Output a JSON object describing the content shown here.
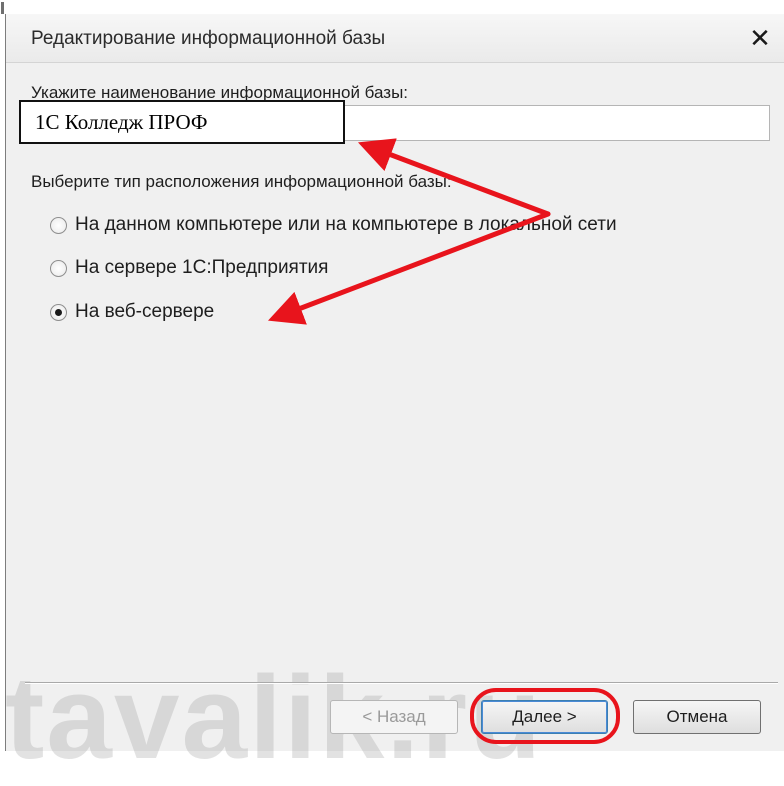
{
  "window": {
    "title": "Редактирование информационной базы",
    "close_glyph": "✕"
  },
  "form": {
    "name_label": "Укажите наименование информационной базы:",
    "name_value": "1С Колледж ПРОФ",
    "location_label": "Выберите тип расположения информационной базы:",
    "options": [
      {
        "label": "На данном компьютере или на компьютере в локальной сети",
        "checked": false
      },
      {
        "label": "На сервере 1С:Предприятия",
        "checked": false
      },
      {
        "label": "На веб-сервере",
        "checked": true
      }
    ]
  },
  "buttons": {
    "back_label": "< Назад",
    "back_enabled": false,
    "next_label": "Далее >",
    "cancel_label": "Отмена"
  },
  "watermark": "tavalik.ru",
  "colors": {
    "annotation_red": "#e8141c",
    "window_bg": "#f0f0f0"
  },
  "icons": [
    "close-icon",
    "radio-button-icon",
    "annotation-arrow",
    "annotation-ellipse"
  ]
}
